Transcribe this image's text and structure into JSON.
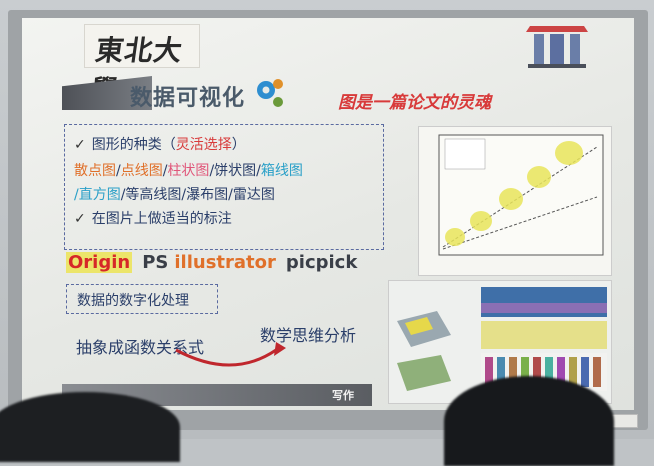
{
  "slide": {
    "logo_text": "東北大學",
    "title": "数据可视化",
    "subtitle": "图是一篇论文的灵魂",
    "line1_check": "✓",
    "line1_main": "图形的种类（",
    "line1_accent": "灵活选择",
    "line1_end": "）",
    "line2_a": "散点图",
    "line2_sep1": "/",
    "line2_b": "点线图",
    "line2_sep2": "/",
    "line2_c": "柱状图",
    "line2_sep3": "/饼状图/",
    "line2_d": "箱线图",
    "line3_a": "/直方图",
    "line3_rest": "/等高线图/瀑布图/雷达图",
    "line4_check": "✓",
    "line4_main": "在图片上做适当的标注",
    "software_origin": "Origin",
    "software_ps": "PS",
    "software_illustrator": "illustrator",
    "software_picpick": "picpick",
    "digitize": "数据的数字化处理",
    "abstract": "抽象成函数关系式",
    "math_thinking": "数学思维分析",
    "footer": "写作"
  },
  "colors": {
    "accent_red": "#d83a3a",
    "accent_orange": "#e0702a",
    "accent_blue": "#2aa0c8",
    "text_navy": "#2b3f6a"
  }
}
